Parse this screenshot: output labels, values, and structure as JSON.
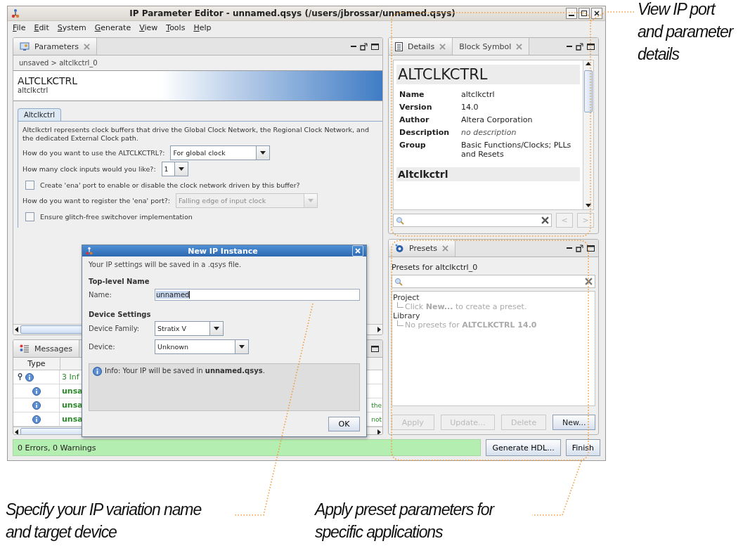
{
  "window": {
    "title": "IP Parameter Editor - unnamed.qsys (/users/jbrossar/unnamed.qsys)"
  },
  "menu": [
    "File",
    "Edit",
    "System",
    "Generate",
    "View",
    "Tools",
    "Help"
  ],
  "parameters_panel": {
    "tabs": [
      {
        "label": "Parameters",
        "selected": true
      }
    ],
    "breadcrumb": "unsaved > altclkctrl_0",
    "header": {
      "title": "ALTCLKCTRL",
      "subtitle": "altclkctrl"
    },
    "inner_tabs": [
      {
        "label": "Altclkctrl",
        "selected": true
      }
    ],
    "description": "Altclkctrl represents clock buffers that drive the Global Clock Network, the Regional Clock Network, and the dedicated External Clock path.",
    "fields": [
      {
        "kind": "select",
        "label": "How do you want to use the ALTCLKCTRL?:",
        "value": "For global clock",
        "disabled": false
      },
      {
        "kind": "select",
        "label": "How many clock inputs would you like?:",
        "value": "1",
        "disabled": false
      },
      {
        "kind": "checkbox",
        "label": "Create 'ena' port to enable or disable the clock network driven by this buffer?",
        "checked": false
      },
      {
        "kind": "select",
        "label": "How do you want to register the 'ena' port?:",
        "value": "Falling edge of input clock",
        "disabled": true
      },
      {
        "kind": "checkbox",
        "label": "Ensure glitch-free switchover implementation",
        "checked": false
      }
    ]
  },
  "messages_panel": {
    "tab": "Messages",
    "columns": [
      "Type"
    ],
    "rows": [
      {
        "kind": "summary",
        "text": "3 Inf"
      },
      {
        "kind": "message",
        "text": "unsa"
      },
      {
        "kind": "message",
        "text": "unsa",
        "tail": "the"
      },
      {
        "kind": "message",
        "text": "unsa",
        "tail": "not"
      }
    ]
  },
  "details_panel": {
    "tabs": [
      {
        "label": "Details",
        "selected": true
      },
      {
        "label": "Block Symbol",
        "selected": false
      }
    ],
    "title": "ALTCLKCTRL",
    "rows": [
      {
        "label": "Name",
        "value": "altclkctrl",
        "italic": false
      },
      {
        "label": "Version",
        "value": "14.0",
        "italic": false
      },
      {
        "label": "Author",
        "value": "Altera Corporation",
        "italic": false
      },
      {
        "label": "Description",
        "value": "no description",
        "italic": true
      },
      {
        "label": "Group",
        "value": "Basic Functions/Clocks; PLLs and Resets",
        "italic": false
      }
    ],
    "section": "Altclkctrl",
    "nav": [
      "<",
      ">"
    ]
  },
  "presets_panel": {
    "tab": "Presets",
    "label": "Presets for altclkctrl_0",
    "tree": [
      {
        "label": "Project",
        "children": [
          {
            "label": "Click **New...** to create a preset."
          }
        ]
      },
      {
        "label": "Library",
        "children": [
          {
            "label": "No presets for **ALTCLKCTRL 14.0**"
          }
        ]
      }
    ],
    "buttons": [
      {
        "label": "Apply",
        "disabled": true
      },
      {
        "label": "Update...",
        "disabled": true
      },
      {
        "label": "Delete",
        "disabled": true
      },
      {
        "label": "New...",
        "disabled": false
      }
    ]
  },
  "status_bar": {
    "text": "0 Errors, 0 Warnings"
  },
  "actions": [
    "Generate HDL...",
    "Finish"
  ],
  "dialog": {
    "title": "New IP Instance",
    "intro": "Your IP settings will be saved in a .qsys file.",
    "sections": [
      {
        "heading": "Top-level Name",
        "fields": [
          {
            "kind": "text",
            "label": "Name:",
            "value": "unnamed"
          }
        ]
      },
      {
        "heading": "Device Settings",
        "fields": [
          {
            "kind": "select",
            "label": "Device Family:",
            "value": "Stratix V"
          },
          {
            "kind": "select",
            "label": "Device:",
            "value": "Unknown"
          }
        ]
      }
    ],
    "info": "Info: Your IP will be saved in **unnamed.qsys**.",
    "buttons": [
      "OK"
    ]
  },
  "annotations": [
    {
      "text": "View IP port and parameter details"
    },
    {
      "text": "Specify your IP variation name and target device"
    },
    {
      "text": "Apply preset parameters for specific applications"
    }
  ]
}
